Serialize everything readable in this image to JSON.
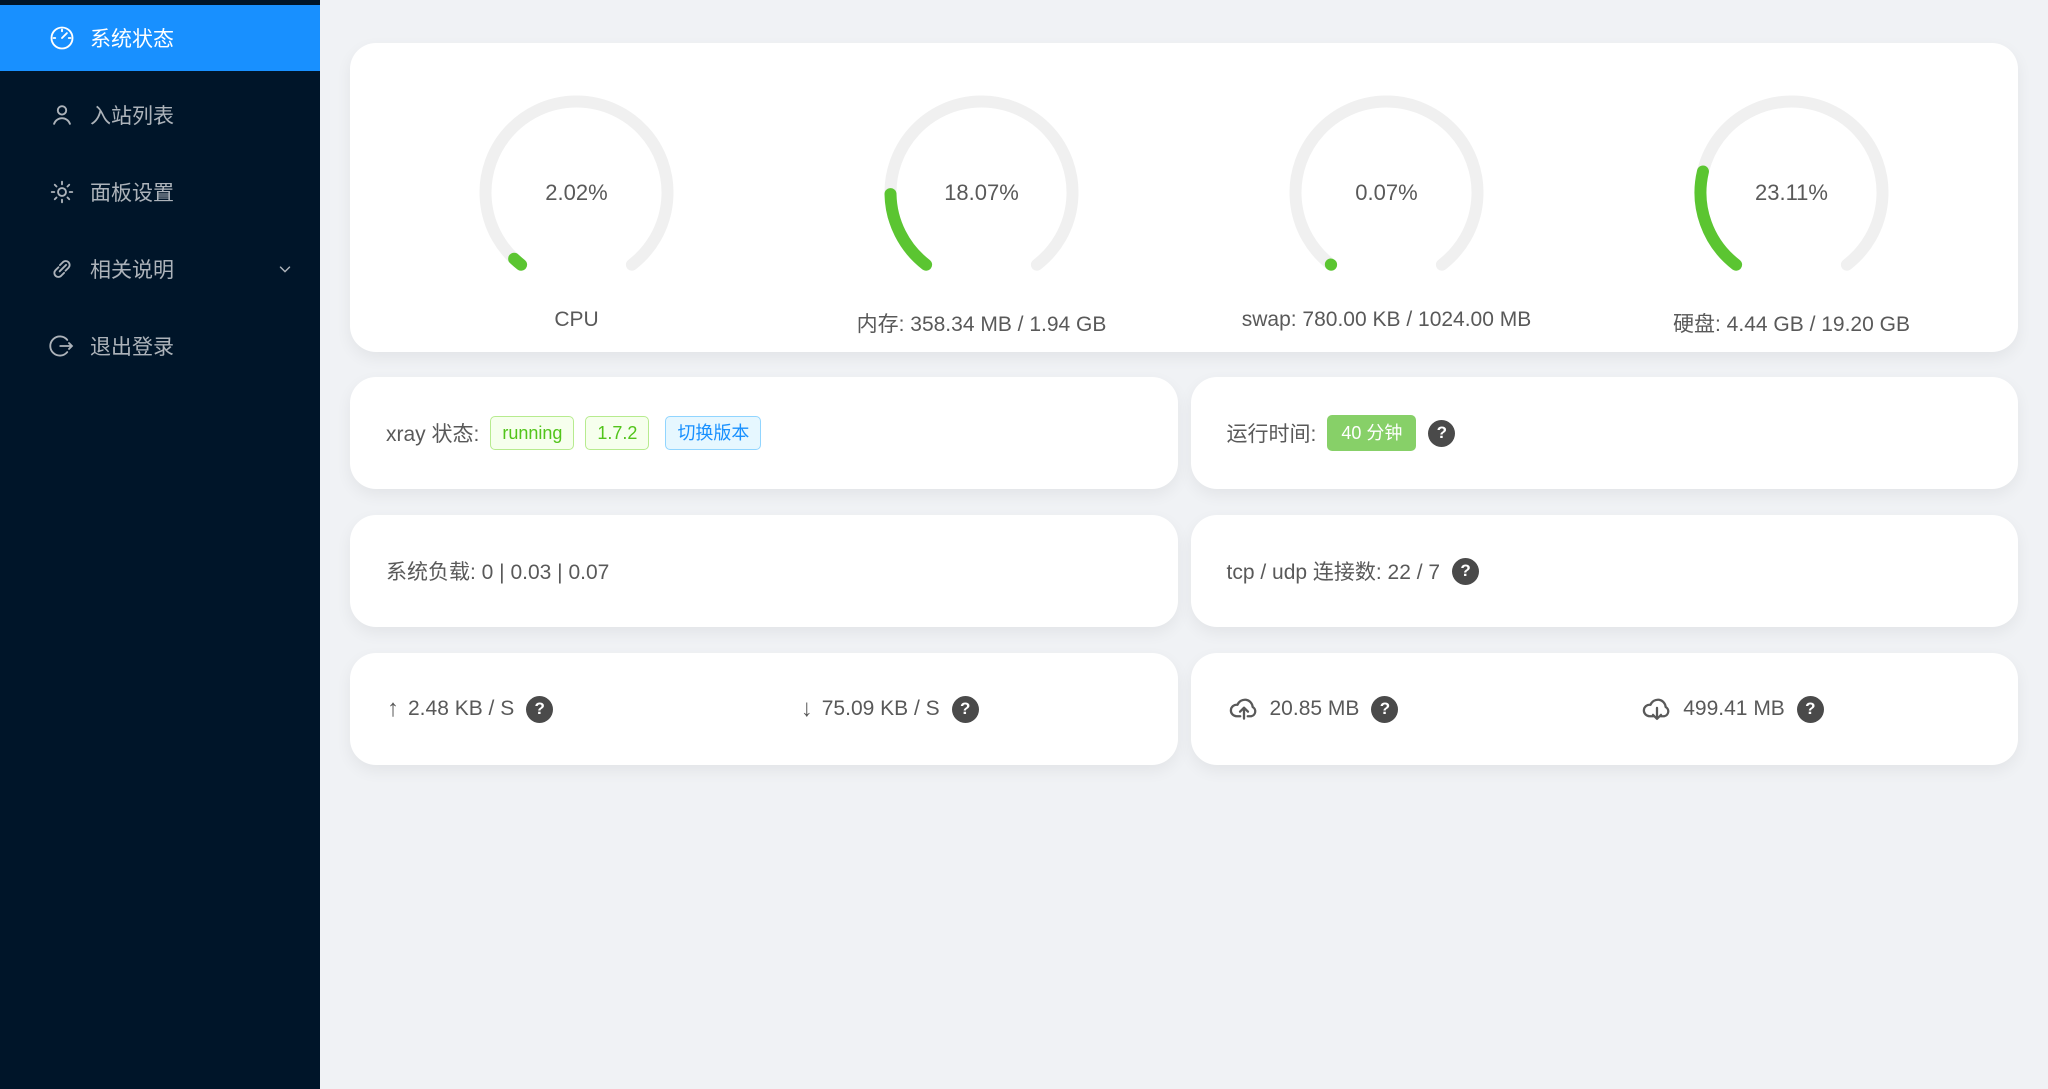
{
  "colors": {
    "accent": "#1890ff",
    "sidebar_bg": "#001529",
    "gauge_green": "#5bc531",
    "gauge_track": "#f0f0f0",
    "tag_green_text": "#52c41a",
    "badge_green": "#87d068",
    "text": "#595959"
  },
  "sidebar": {
    "items": [
      {
        "label": "系统状态",
        "icon": "dashboard-icon",
        "active": true
      },
      {
        "label": "入站列表",
        "icon": "user-icon",
        "active": false
      },
      {
        "label": "面板设置",
        "icon": "gear-icon",
        "active": false
      },
      {
        "label": "相关说明",
        "icon": "link-icon",
        "active": false,
        "has_submenu": true
      },
      {
        "label": "退出登录",
        "icon": "logout-icon",
        "active": false
      }
    ]
  },
  "gauges": [
    {
      "percent": 2.02,
      "value_text": "2.02%",
      "label": "CPU"
    },
    {
      "percent": 18.07,
      "value_text": "18.07%",
      "label": "内存: 358.34 MB / 1.94 GB"
    },
    {
      "percent": 0.07,
      "value_text": "0.07%",
      "label": "swap: 780.00 KB / 1024.00 MB"
    },
    {
      "percent": 23.11,
      "value_text": "23.11%",
      "label": "硬盘: 4.44 GB / 19.20 GB"
    }
  ],
  "xray": {
    "label": "xray 状态:",
    "status": "running",
    "version": "1.7.2",
    "switch_version": "切换版本"
  },
  "uptime": {
    "label": "运行时间:",
    "value": "40 分钟"
  },
  "system_load": {
    "text": "系统负载: 0 | 0.03 | 0.07"
  },
  "connections": {
    "text": "tcp / udp 连接数: 22 / 7"
  },
  "net_speed": {
    "upload": "2.48 KB / S",
    "download": "75.09 KB / S"
  },
  "net_total": {
    "upload": "20.85 MB",
    "download": "499.41 MB"
  },
  "icons": {
    "question": "?",
    "arrow_up": "↑",
    "arrow_down": "↓"
  }
}
